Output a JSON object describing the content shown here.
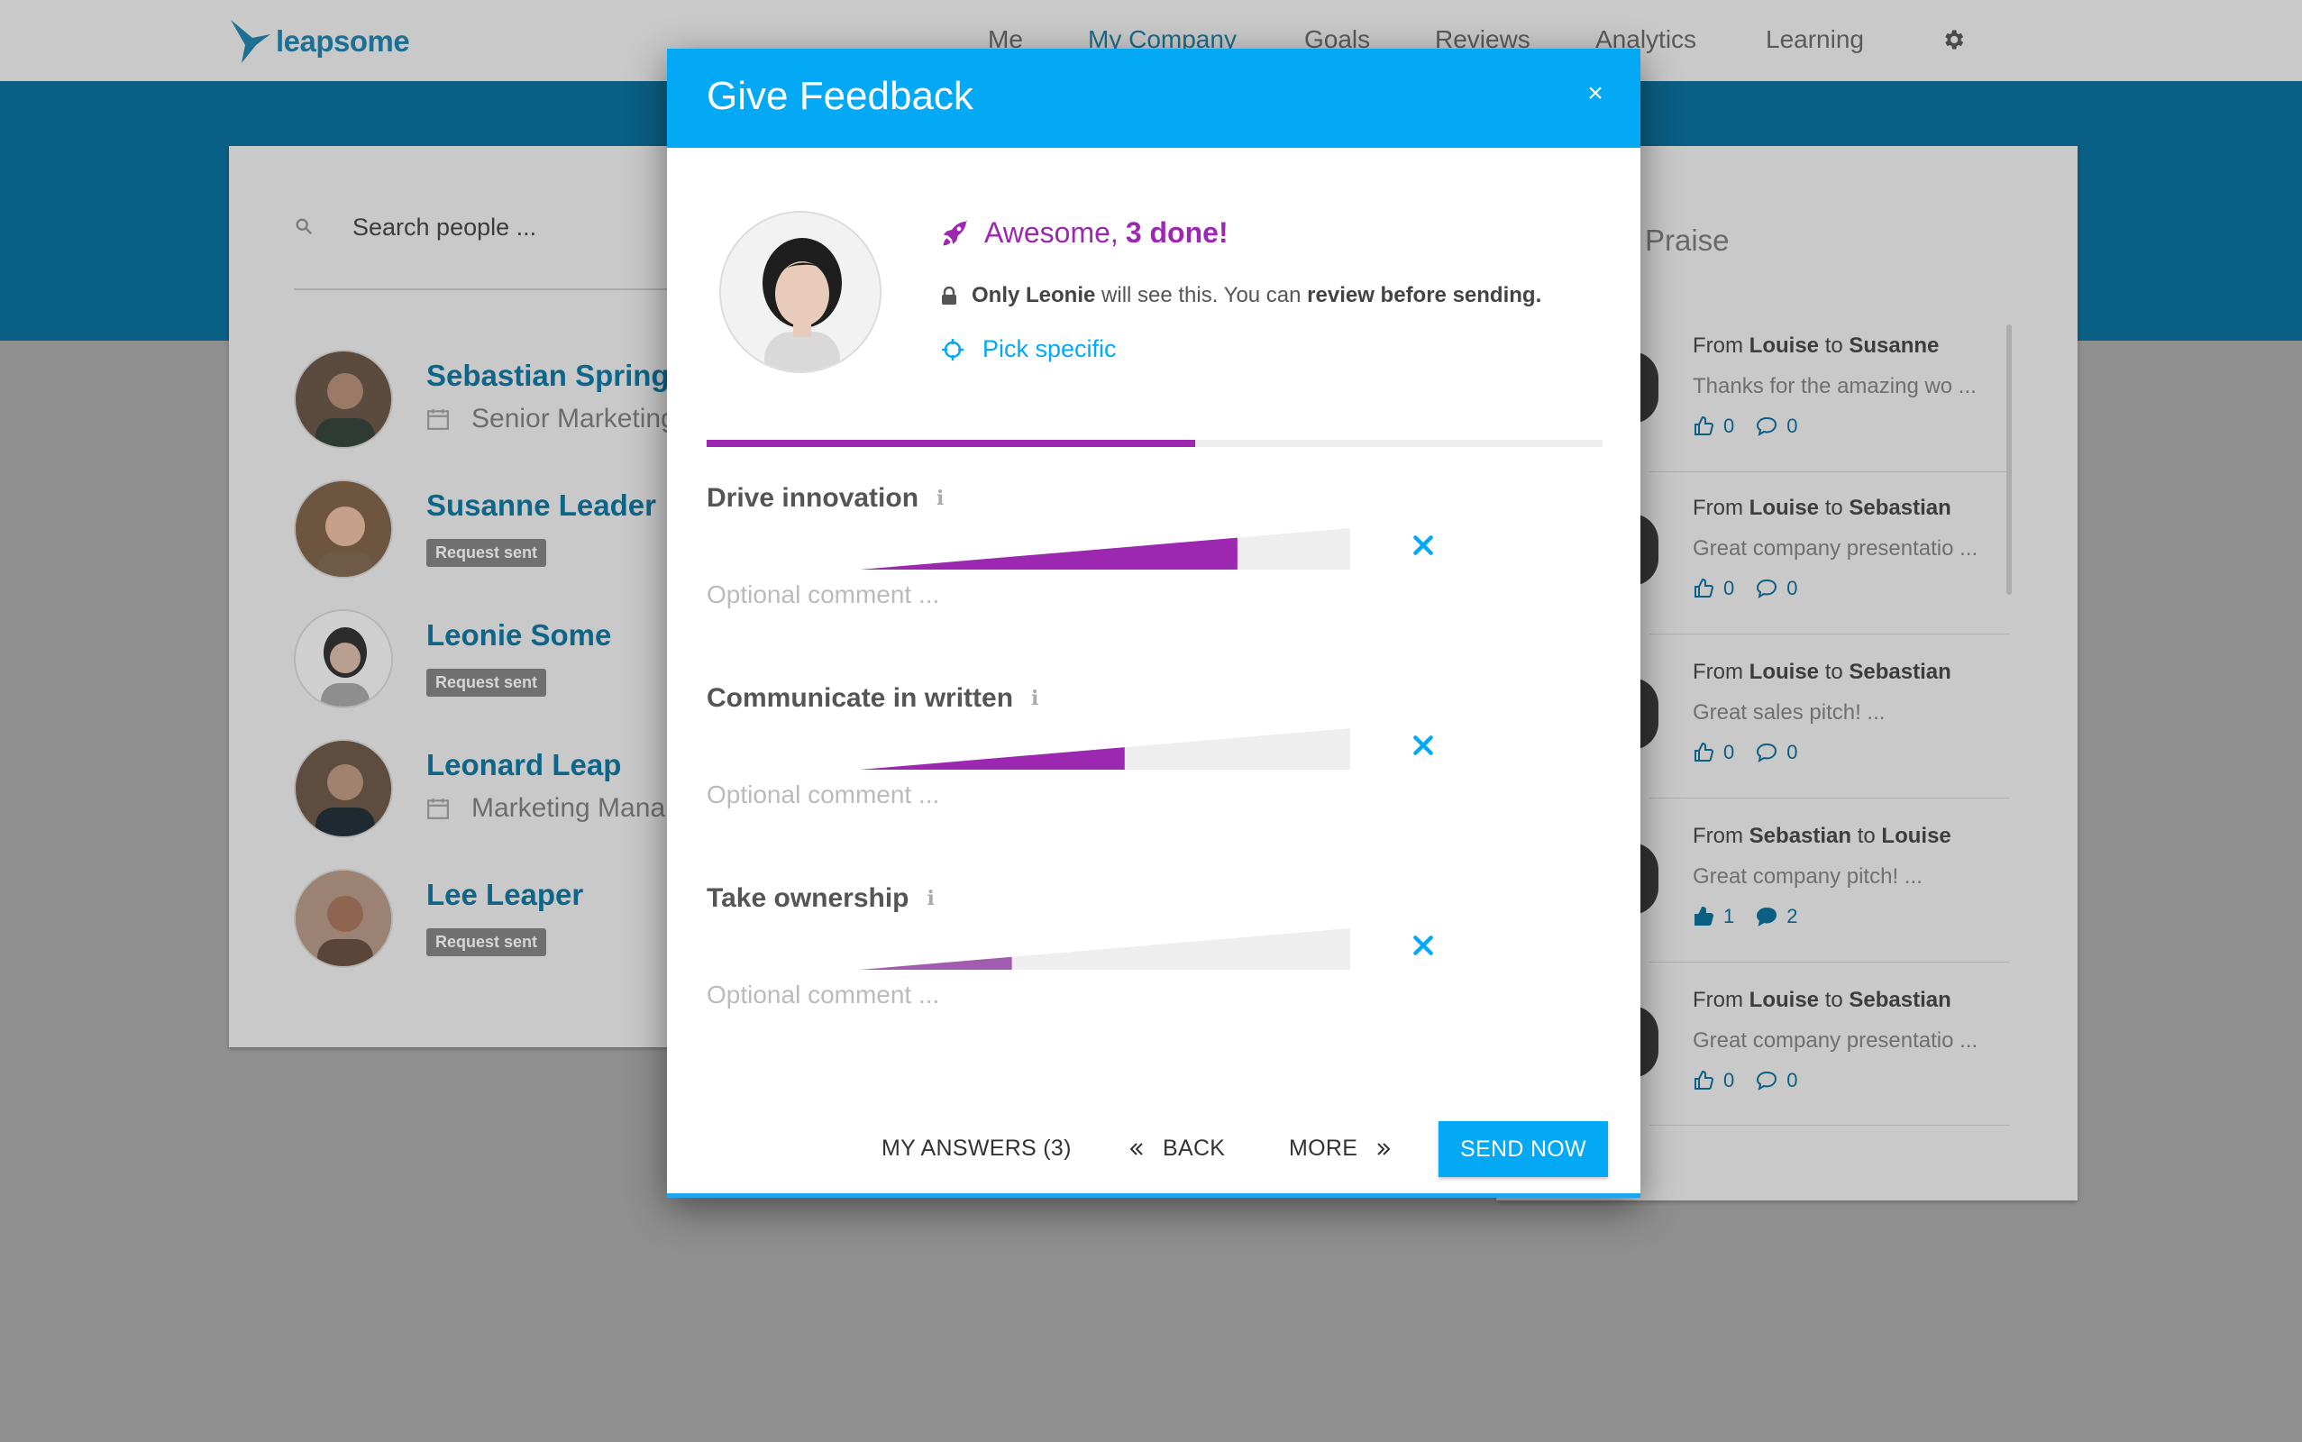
{
  "app": {
    "logo_text": "leapsome"
  },
  "nav": {
    "items": [
      {
        "label": "Me"
      },
      {
        "label": "My Company"
      },
      {
        "label": "Goals"
      },
      {
        "label": "Reviews"
      },
      {
        "label": "Analytics"
      },
      {
        "label": "Learning"
      }
    ],
    "active": "My Company",
    "settings_icon": "gear-icon"
  },
  "search": {
    "placeholder": "Search people ..."
  },
  "people": [
    {
      "name": "Sebastian Springer",
      "subtitle": "Senior Marketing",
      "badge": ""
    },
    {
      "name": "Susanne Leader",
      "subtitle": "",
      "badge": "Request sent"
    },
    {
      "name": "Leonie Some",
      "subtitle": "",
      "badge": "Request sent"
    },
    {
      "name": "Leonard Leap",
      "subtitle": "Marketing Mana",
      "badge": ""
    },
    {
      "name": "Lee Leaper",
      "subtitle": "",
      "badge": "Request sent"
    }
  ],
  "praise": {
    "title": "Praise",
    "items": [
      {
        "from_label": "From",
        "from": "Louise",
        "to_label": "to",
        "to": "Susanne",
        "text": "Thanks for the amazing wo ...",
        "likes": "0",
        "comments": "0",
        "liked": false
      },
      {
        "from_label": "From",
        "from": "Louise",
        "to_label": "to",
        "to": "Sebastian",
        "text": "Great company presentatio ...",
        "likes": "0",
        "comments": "0",
        "liked": false
      },
      {
        "from_label": "From",
        "from": "Louise",
        "to_label": "to",
        "to": "Sebastian",
        "text": "Great sales pitch! ...",
        "likes": "0",
        "comments": "0",
        "liked": false
      },
      {
        "from_label": "From",
        "from": "Sebastian",
        "to_label": "to",
        "to": "Louise",
        "text": "Great company pitch! ...",
        "likes": "1",
        "comments": "2",
        "liked": true
      },
      {
        "from_label": "From",
        "from": "Louise",
        "to_label": "to",
        "to": "Sebastian",
        "text": "Great company presentatio ...",
        "likes": "0",
        "comments": "0",
        "liked": false
      }
    ]
  },
  "modal": {
    "title": "Give Feedback",
    "close_label": "×",
    "status_prefix": "Awesome,",
    "status_count": "3 done!",
    "privacy": {
      "bold1": "Only Leonie",
      "text1": " will see this. You can ",
      "bold2": "review before sending."
    },
    "pick_label": "Pick specific",
    "progress_fraction": 0.545,
    "questions": [
      {
        "title": "Drive innovation",
        "value": 0.77,
        "comment_placeholder": "Optional comment ..."
      },
      {
        "title": "Communicate in written",
        "value": 0.54,
        "comment_placeholder": "Optional comment ..."
      },
      {
        "title": "Take ownership",
        "value": 0.31,
        "comment_placeholder": "Optional comment ..."
      }
    ],
    "footer": {
      "my_answers": "MY ANSWERS (3)",
      "back": "BACK",
      "more": "MORE",
      "send": "SEND NOW"
    }
  },
  "colors": {
    "accent_blue": "#03a9f4",
    "accent_purple": "#9c27b0",
    "name_blue": "#0d6589"
  }
}
